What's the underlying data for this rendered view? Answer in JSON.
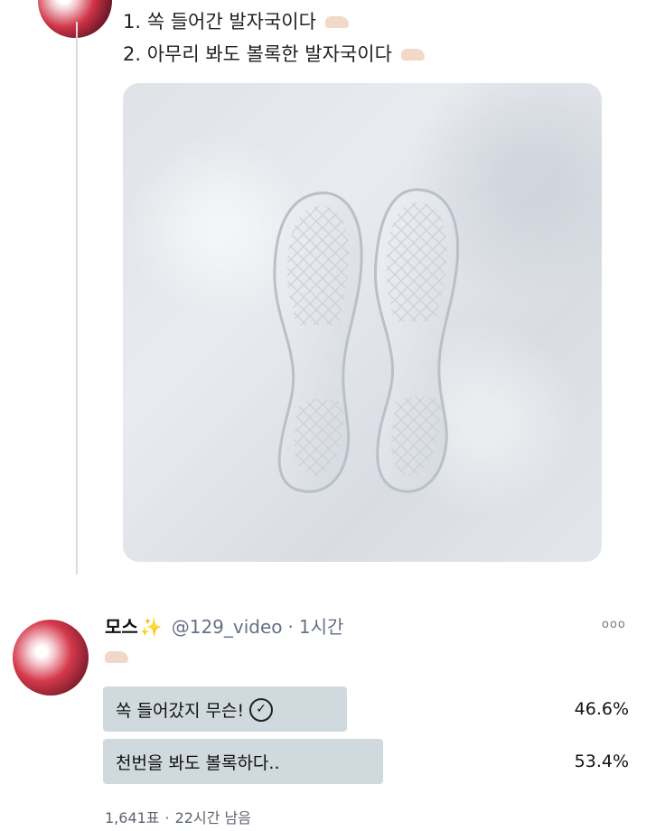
{
  "top_tweet": {
    "lines": [
      "1. 쏙 들어간 발자국이다",
      "2. 아무리 봐도 볼록한 발자국이다"
    ],
    "line_emoji": "foot-emoji"
  },
  "reply": {
    "name": "모스",
    "name_emoji": "✨",
    "handle": "@129_video",
    "time": "1시간",
    "more_label": "ooo",
    "body_emoji": "foot-emoji",
    "poll": {
      "options": [
        {
          "label": "쏙 들어갔지 무슨!",
          "percent": "46.6%",
          "share": 0.466,
          "selected": true
        },
        {
          "label": "천번을 봐도 볼록하다..",
          "percent": "53.4%",
          "share": 0.534,
          "selected": false
        }
      ],
      "votes": "1,641표",
      "remaining": "22시간 남음"
    }
  },
  "colors": {
    "poll_bar": "#cfd9de",
    "accent_sparkle": "#f2b21c",
    "meta_text": "#667085"
  }
}
